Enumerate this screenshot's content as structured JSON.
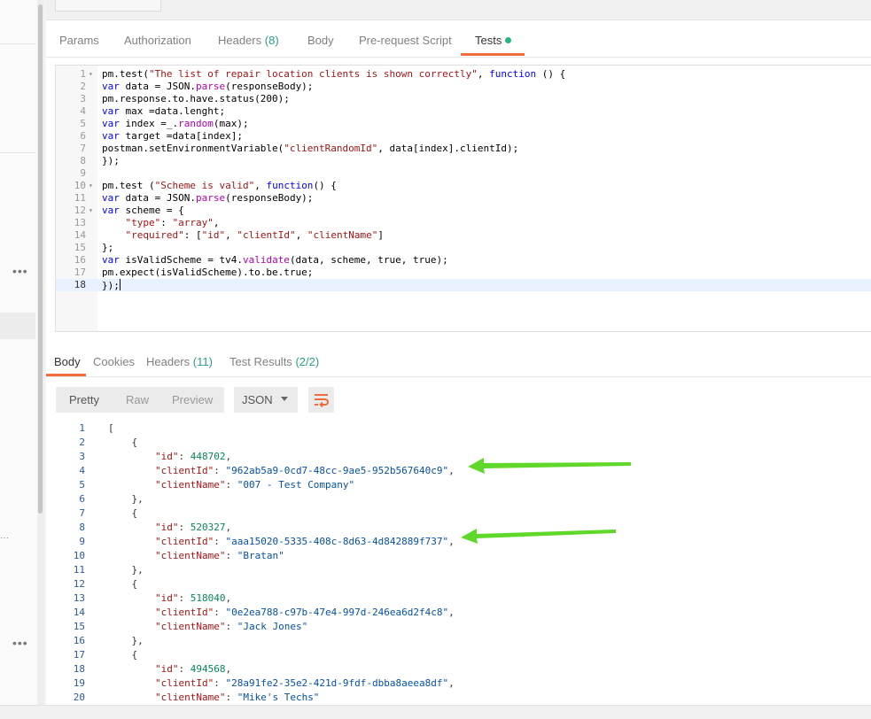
{
  "request_tabs": [
    {
      "label": "Params"
    },
    {
      "label": "Authorization"
    },
    {
      "label": "Headers",
      "count": "(8)"
    },
    {
      "label": "Body"
    },
    {
      "label": "Pre-request Script"
    },
    {
      "label": "Tests",
      "active": true,
      "indicator": "dot"
    }
  ],
  "editor": {
    "current_line": 18,
    "lines": [
      {
        "n": "1",
        "fold": true,
        "text": "pm.test(\"The list of repair location clients is shown correctly\", function () {"
      },
      {
        "n": "2",
        "text": "var data = JSON.parse(responseBody);"
      },
      {
        "n": "3",
        "text": "pm.response.to.have.status(200);"
      },
      {
        "n": "4",
        "text": "var max =data.lenght;"
      },
      {
        "n": "5",
        "text": "var index =_.random(max);"
      },
      {
        "n": "6",
        "text": "var target =data[index];"
      },
      {
        "n": "7",
        "text": "postman.setEnvironmentVariable(\"clientRandomId\", data[index].clientId);"
      },
      {
        "n": "8",
        "text": "});"
      },
      {
        "n": "9",
        "text": ""
      },
      {
        "n": "10",
        "fold": true,
        "text": "pm.test (\"Scheme is valid\", function() {"
      },
      {
        "n": "11",
        "text": "var data = JSON.parse(responseBody);"
      },
      {
        "n": "12",
        "fold": true,
        "text": "var scheme = {"
      },
      {
        "n": "13",
        "text": "    \"type\": \"array\","
      },
      {
        "n": "14",
        "text": "    \"required\": [\"id\", \"clientId\", \"clientName\"]"
      },
      {
        "n": "15",
        "text": "};"
      },
      {
        "n": "16",
        "text": "var isValidScheme = tv4.validate(data, scheme, true, true);"
      },
      {
        "n": "17",
        "text": "pm.expect(isValidScheme).to.be.true;"
      },
      {
        "n": "18",
        "text": "});"
      }
    ]
  },
  "response_tabs": [
    {
      "label": "Body",
      "active": true
    },
    {
      "label": "Cookies"
    },
    {
      "label": "Headers",
      "count": "(11)"
    },
    {
      "label": "Test Results",
      "count": "(2/2)"
    }
  ],
  "toolbar": {
    "pretty": "Pretty",
    "raw": "Raw",
    "preview": "Preview",
    "format": "JSON"
  },
  "response_lines": [
    {
      "n": "1",
      "text": "["
    },
    {
      "n": "2",
      "text": "    {"
    },
    {
      "n": "3",
      "text": "        \"id\": 448702,"
    },
    {
      "n": "4",
      "text": "        \"clientId\": \"962ab5a9-0cd7-48cc-9ae5-952b567640c9\","
    },
    {
      "n": "5",
      "text": "        \"clientName\": \"007 - Test Company\""
    },
    {
      "n": "6",
      "text": "    },"
    },
    {
      "n": "7",
      "text": "    {"
    },
    {
      "n": "8",
      "text": "        \"id\": 520327,"
    },
    {
      "n": "9",
      "text": "        \"clientId\": \"aaa15020-5335-408c-8d63-4d842889f737\","
    },
    {
      "n": "10",
      "text": "        \"clientName\": \"Bratan\""
    },
    {
      "n": "11",
      "text": "    },"
    },
    {
      "n": "12",
      "text": "    {"
    },
    {
      "n": "13",
      "text": "        \"id\": 518040,"
    },
    {
      "n": "14",
      "text": "        \"clientId\": \"0e2ea788-c97b-47e4-997d-246ea6d2f4c8\","
    },
    {
      "n": "15",
      "text": "        \"clientName\": \"Jack Jones\""
    },
    {
      "n": "16",
      "text": "    },"
    },
    {
      "n": "17",
      "text": "    {"
    },
    {
      "n": "18",
      "text": "        \"id\": 494568,"
    },
    {
      "n": "19",
      "text": "        \"clientId\": \"28a91fe2-35e2-421d-9fdf-dbba8aeea8df\","
    },
    {
      "n": "20",
      "text": "        \"clientName\": \"Mike's Techs\""
    }
  ],
  "icons": {
    "sidebar_more_1": "more-horizontal-icon",
    "sidebar_more_2": "more-horizontal-icon",
    "wrap": "wrap-lines-icon",
    "format_dropdown": "chevron-down-icon",
    "annotation": "green-arrow-icon"
  },
  "colors": {
    "accent": "#f26b3a",
    "tests_indicator": "#26b47f",
    "count": "#2a9c88",
    "annotation_arrow": "#5fd82a"
  }
}
